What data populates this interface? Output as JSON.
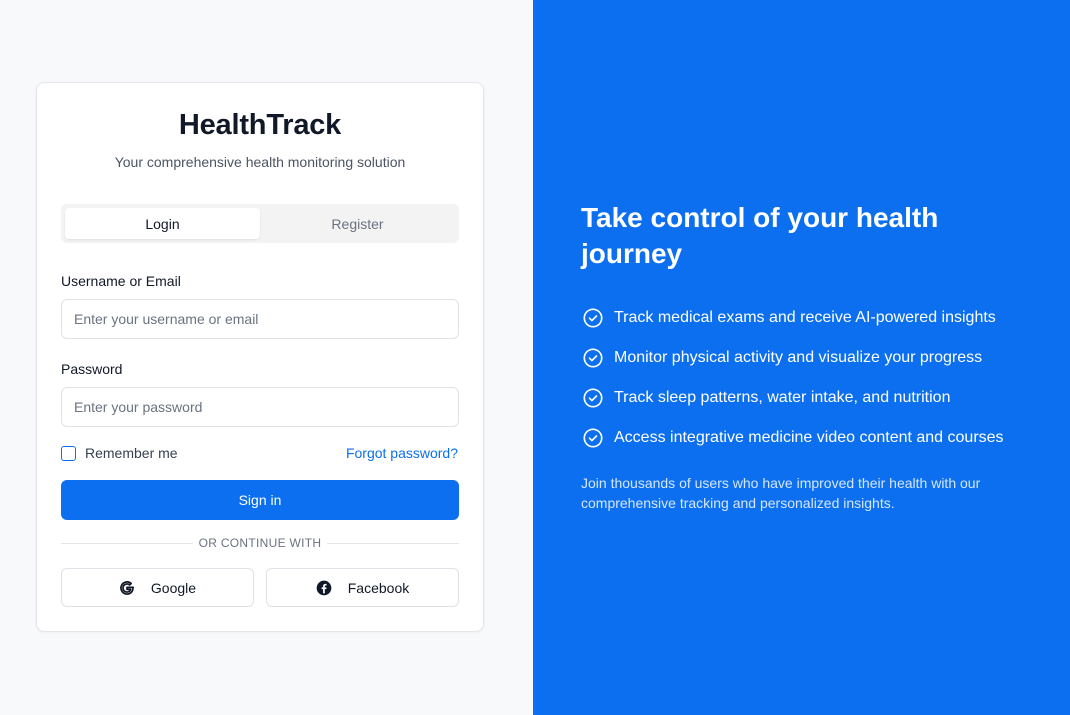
{
  "brand": {
    "title": "HealthTrack",
    "tagline": "Your comprehensive health monitoring solution"
  },
  "tabs": [
    {
      "label": "Login",
      "active": true
    },
    {
      "label": "Register",
      "active": false
    }
  ],
  "form": {
    "username_label": "Username or Email",
    "username_placeholder": "Enter your username or email",
    "username_value": "",
    "password_label": "Password",
    "password_placeholder": "Enter your password",
    "password_value": "",
    "remember_label": "Remember me",
    "remember_checked": false,
    "forgot_label": "Forgot password?",
    "signin_label": "Sign in",
    "divider_label": "OR CONTINUE WITH",
    "google_label": "Google",
    "facebook_label": "Facebook"
  },
  "hero": {
    "headline": "Take control of your health journey",
    "features": [
      {
        "icon": "check-circle-icon",
        "text": "Track medical exams and receive AI-powered insights"
      },
      {
        "icon": "check-circle-icon",
        "text": "Monitor physical activity and visualize your progress"
      },
      {
        "icon": "check-circle-icon",
        "text": "Track sleep patterns, water intake, and nutrition"
      },
      {
        "icon": "check-circle-icon",
        "text": "Access integrative medicine video content and courses"
      }
    ],
    "blurb": "Join thousands of users who have improved their health with our comprehensive tracking and personalized insights."
  },
  "colors": {
    "accent": "#0b6ff0",
    "page_background": "#f8f9fb",
    "card_background": "#ffffff"
  }
}
